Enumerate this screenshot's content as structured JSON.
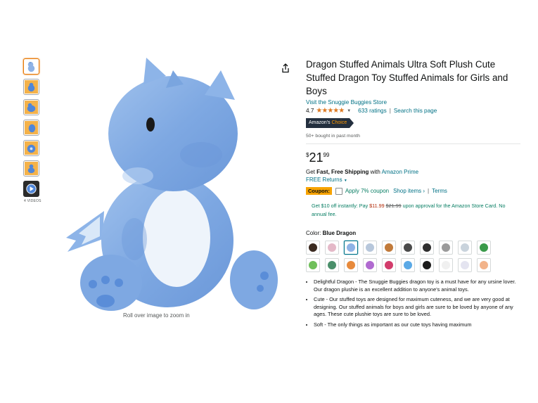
{
  "thumbnails": {
    "videos_label": "4 VIDEOS"
  },
  "image": {
    "zoom_hint": "Roll over image to zoom in"
  },
  "product": {
    "title": "Dragon Stuffed Animals Ultra Soft Plush Cute Stuffed Dragon Toy Stuffed Animals for Girls and Boys",
    "store_link": "Visit the Snuggie Buggies Store",
    "rating": "4.7",
    "stars": "★★★★★",
    "ratings_count": "633 ratings",
    "search_page": "Search this page",
    "badge_prefix": "Amazon's",
    "badge_choice": "Choice",
    "bought": "50+ bought in past month"
  },
  "price": {
    "symbol": "$",
    "whole": "21",
    "fraction": "99"
  },
  "shipping": {
    "prefix": "Get ",
    "bold": "Fast, Free Shipping",
    "mid": " with ",
    "prime_link": "Amazon Prime",
    "free_returns": "FREE Returns"
  },
  "coupon": {
    "label": "Coupon:",
    "text": "Apply 7% coupon",
    "shop_items": "Shop items ›",
    "sep": "|",
    "terms": "Terms"
  },
  "card_offer": {
    "part1": "Get $10 off instantly: Pay ",
    "new_price": "$11.99",
    "old_price": "$21.99",
    "part2": " upon approval for the Amazon Store Card. No annual fee."
  },
  "color": {
    "label": "Color: ",
    "selected": "Blue Dragon",
    "swatch_colors": [
      "#3b2a20",
      "#e4b9c8",
      "#8fb3e6",
      "#b7c7db",
      "#c17a3a",
      "#4a4a4a",
      "#2e2e2e",
      "#9a9a9a",
      "#c9d3dc",
      "#3a9a4a",
      "#6fbf5a",
      "#4a8f6a",
      "#e78a3c",
      "#b06ad0",
      "#d23c6b",
      "#5aa9e6",
      "#1b1b1b",
      "#f0f0f0",
      "#e4e4f0",
      "#f2b38a"
    ]
  },
  "bullets": [
    "Delightful Dragon - The Snuggie Buggies dragon toy is a must have for any ursine lover. Our dragon plushie is an excellent addition to anyone's animal toys.",
    "Cute - Our stuffed toys are designed for maximum cuteness, and we are very good at designing. Our stuffed animals for boys and girls are sure to be loved by anyone of any ages. These cute plushie toys are sure to be loved.",
    "Soft - The only things as important as our cute toys having maximum"
  ]
}
